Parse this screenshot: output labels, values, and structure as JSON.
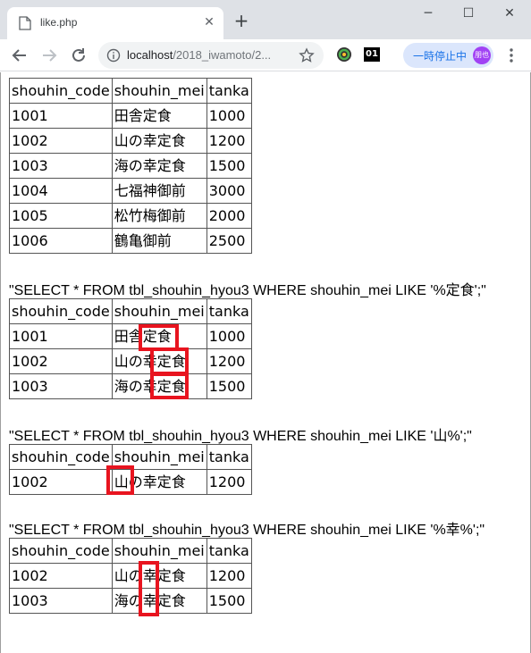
{
  "browser": {
    "tab_title": "like.php",
    "url_host": "localhost",
    "url_path": "/2018_iwamoto/2...",
    "pause_label": "一時停止中",
    "avatar_label": "朋也",
    "ext_badge": "01"
  },
  "tables": [
    {
      "headers": [
        "shouhin_code",
        "shouhin_mei",
        "tanka"
      ],
      "rows": [
        [
          "1001",
          "田舎定食",
          "1000"
        ],
        [
          "1002",
          "山の幸定食",
          "1200"
        ],
        [
          "1003",
          "海の幸定食",
          "1500"
        ],
        [
          "1004",
          "七福神御前",
          "3000"
        ],
        [
          "1005",
          "松竹梅御前",
          "2000"
        ],
        [
          "1006",
          "鶴亀御前",
          "2500"
        ]
      ]
    },
    {
      "query": "\"SELECT * FROM tbl_shouhin_hyou3 WHERE shouhin_mei LIKE '%定食';\"",
      "headers": [
        "shouhin_code",
        "shouhin_mei",
        "tanka"
      ],
      "rows": [
        [
          "1001",
          "田舎定食",
          "1000"
        ],
        [
          "1002",
          "山の幸定食",
          "1200"
        ],
        [
          "1003",
          "海の幸定食",
          "1500"
        ]
      ]
    },
    {
      "query": "\"SELECT * FROM tbl_shouhin_hyou3 WHERE shouhin_mei LIKE '山%';\"",
      "headers": [
        "shouhin_code",
        "shouhin_mei",
        "tanka"
      ],
      "rows": [
        [
          "1002",
          "山の幸定食",
          "1200"
        ]
      ]
    },
    {
      "query": "\"SELECT * FROM tbl_shouhin_hyou3 WHERE shouhin_mei LIKE '%幸%';\"",
      "headers": [
        "shouhin_code",
        "shouhin_mei",
        "tanka"
      ],
      "rows": [
        [
          "1002",
          "山の幸定食",
          "1200"
        ],
        [
          "1003",
          "海の幸定食",
          "1500"
        ]
      ]
    }
  ],
  "colors": {
    "highlight": "#e8141f",
    "tabstrip": "#dee1e6",
    "pause_pill": "#dbe6fc"
  }
}
